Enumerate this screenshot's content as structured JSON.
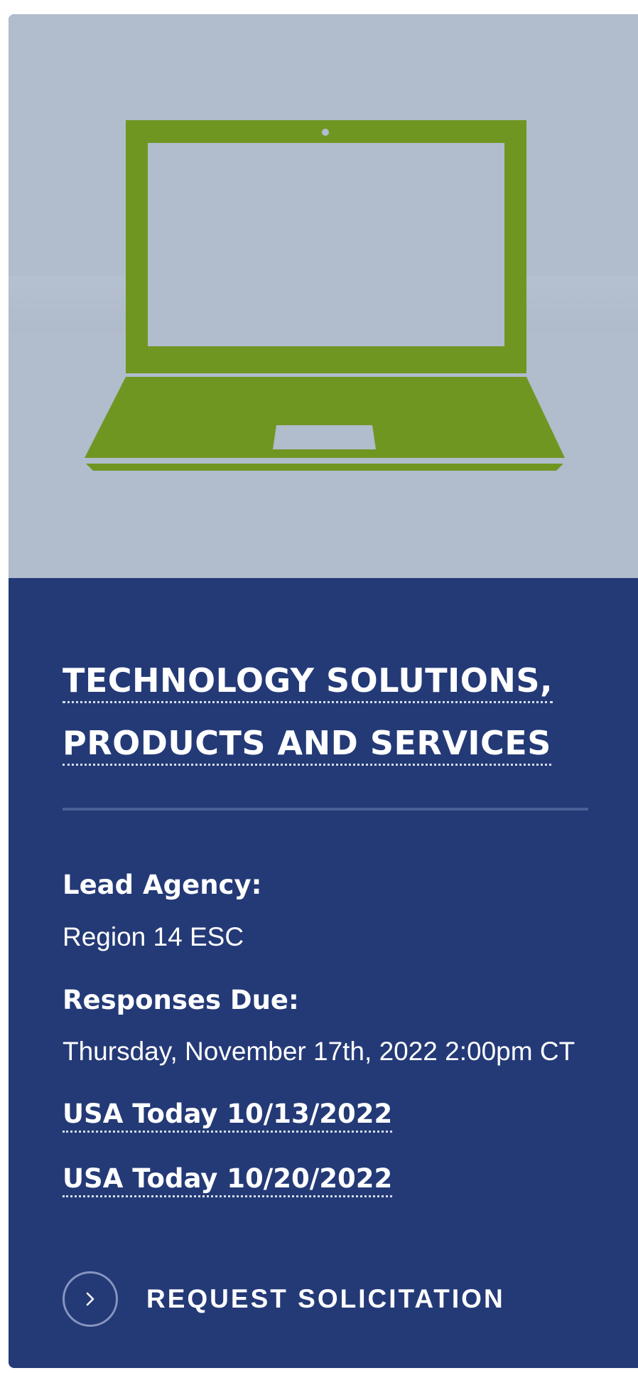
{
  "card": {
    "image_icon": "laptop-icon",
    "title_line1": "TECHNOLOGY SOLUTIONS,",
    "title_line2": "PRODUCTS AND SERVICES",
    "lead_agency_label": "Lead Agency:",
    "lead_agency_value": "Region 14 ESC",
    "responses_due_label": "Responses Due:",
    "responses_due_value": "Thursday, November 17th, 2022 2:00pm CT",
    "links": [
      "USA Today 10/13/2022",
      "USA Today 10/20/2022"
    ],
    "cta_label": "REQUEST SOLICITATION",
    "cta_icon": "chevron-right-icon"
  },
  "colors": {
    "hero_background": "#b1bccd",
    "laptop_green": "#709622",
    "card_navy": "#243a77",
    "divider": "#4a5f96",
    "text": "#ffffff"
  }
}
